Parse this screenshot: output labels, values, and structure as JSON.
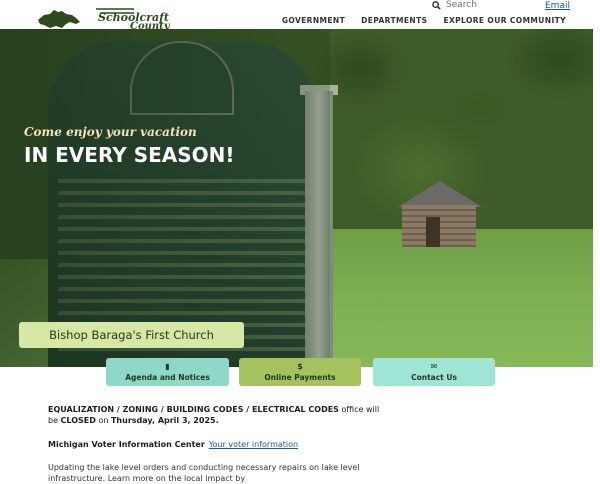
{
  "header": {
    "logo_line1": "Schoolcraft",
    "logo_line2": "County",
    "search_placeholder": "Search",
    "email_label": "Email",
    "nav": [
      "GOVERNMENT",
      "DEPARTMENTS",
      "EXPLORE OUR COMMUNITY"
    ]
  },
  "hero": {
    "tagline_small": "Come enjoy your vacation",
    "tagline_large": "IN EVERY SEASON!",
    "caption": "Bishop Baraga's First Church"
  },
  "quick_links": [
    {
      "label": "Agenda and Notices",
      "icon": "document-icon"
    },
    {
      "label": "Online Payments",
      "icon": "dollar-icon"
    },
    {
      "label": "Contact Us",
      "icon": "envelope-icon"
    }
  ],
  "content": {
    "notice_bold": "EQUALIZATION / ZONING / BUILDING CODES / ELECTRICAL CODES",
    "notice_mid": " office will be ",
    "notice_closed": "CLOSED",
    "notice_on": " on ",
    "notice_date": "Thursday, April 3, 2025.",
    "voter_label": "Michigan Voter Information Center",
    "voter_link": "Your voter information",
    "lake_text": "Updating the lake level orders and conducting necessary repairs on lake level infrastructure. Learn more on the local impact by"
  }
}
